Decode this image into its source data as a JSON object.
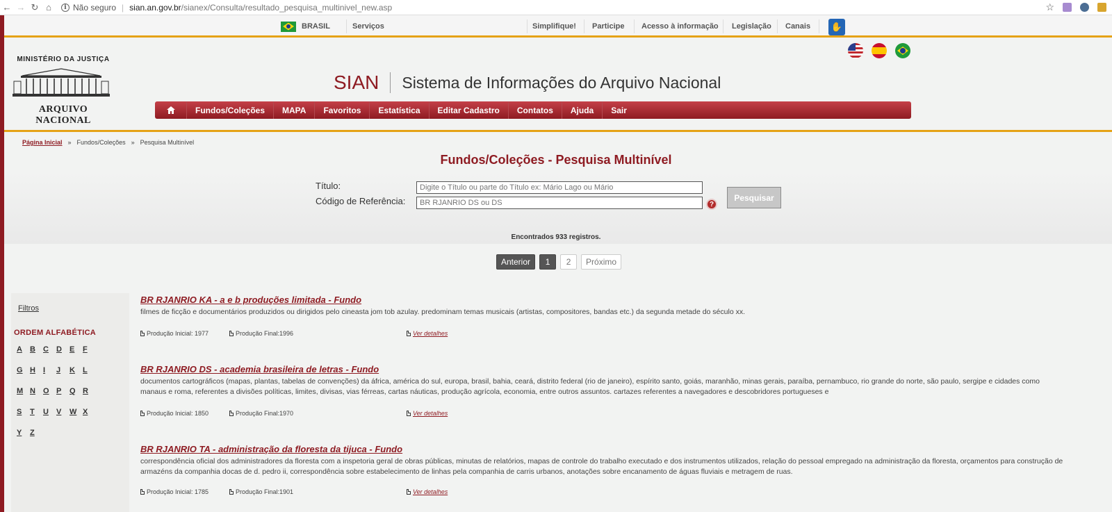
{
  "browser": {
    "security": "Não seguro",
    "url_host": "sian.an.gov.br",
    "url_path": "/sianex/Consulta/resultado_pesquisa_multinivel_new.asp"
  },
  "gov_bar": {
    "country": "BRASIL",
    "services": "Serviços",
    "links": [
      "Simplifique!",
      "Participe",
      "Acesso à informação",
      "Legislação",
      "Canais"
    ]
  },
  "header": {
    "ministry": "MINISTÉRIO DA JUSTIÇA",
    "org": "ARQUIVO NACIONAL",
    "abbr": "SIAN",
    "system_name": "Sistema de Informações do Arquivo Nacional"
  },
  "nav": {
    "home_icon": "home-icon",
    "items": [
      "Fundos/Coleções",
      "MAPA",
      "Favoritos",
      "Estatística",
      "Editar Cadastro",
      "Contatos",
      "Ajuda",
      "Sair"
    ]
  },
  "breadcrumb": {
    "home": "Página Inicial",
    "sep": "»",
    "level1": "Fundos/Coleções",
    "current": "Pesquisa Multinível"
  },
  "page_title": "Fundos/Coleções - Pesquisa Multinível",
  "search": {
    "title_label": "Título:",
    "title_placeholder": "Digite o Título ou parte do Título ex: Mário Lago ou Mário",
    "code_label": "Código de Referência:",
    "code_placeholder": "BR RJANRIO DS ou DS",
    "button": "Pesquisar"
  },
  "results_count": "Encontrados 933 registros.",
  "pagination": {
    "prev": "Anterior",
    "pages": [
      "1",
      "2"
    ],
    "current": "1",
    "next": "Próximo"
  },
  "sidebar": {
    "filters": "Filtros",
    "alpha_title": "ORDEM ALFABÉTICA",
    "rows": [
      [
        "A",
        "B",
        "C",
        "D",
        "E",
        "F"
      ],
      [
        "G",
        "H",
        "I",
        "J",
        "K",
        "L"
      ],
      [
        "M",
        "N",
        "O",
        "P",
        "Q",
        "R"
      ],
      [
        "S",
        "T",
        "U",
        "V",
        "W",
        "X"
      ],
      [
        "Y",
        "Z"
      ]
    ]
  },
  "results": [
    {
      "title": "BR RJANRIO KA - a e b produções limitada - Fundo",
      "desc": [
        "filmes de ficção e documentários produzidos ou dirigidos pelo cineasta jom tob azulay. predominam temas musicais (artistas, compositores, bandas etc.) da segunda metade do século xx."
      ],
      "start": "Produção Inicial: 1977",
      "end": "Produção Final:1996",
      "link": "Ver detalhes"
    },
    {
      "title": "BR RJANRIO DS - academia brasileira de letras - Fundo",
      "desc": [
        "documentos cartográficos (mapas, plantas, tabelas de convenções) da áfrica, américa do sul, europa, brasil, bahia, ceará, distrito federal (rio de janeiro), espírito santo, goiás, maranhão, minas gerais, paraíba, pernambuco, rio grande do norte, são paulo, sergipe e cidades como",
        "manaus e roma, referentes a divisões políticas, limites, divisas, vias férreas, cartas náuticas, produção agrícola, economia, entre outros assuntos. cartazes referentes a navegadores e descobridores portugueses e"
      ],
      "start": "Produção Inicial: 1850",
      "end": "Produção Final:1970",
      "link": "Ver detalhes"
    },
    {
      "title": "BR RJANRIO TA - administração da floresta da tijuca - Fundo",
      "desc": [
        "correspondência oficial dos administradores da floresta com a inspetoria geral de obras públicas, minutas de relatórios, mapas de controle do trabalho executado e dos instrumentos utilizados, relação do pessoal empregado na administração da floresta, orçamentos para construção de",
        "armazéns da companhia docas de d. pedro ii, correspondência sobre estabelecimento de linhas pela companhia de carris urbanos, anotações sobre encanamento de águas fluviais e metragem de ruas."
      ],
      "start": "Produção Inicial: 1785",
      "end": "Produção Final:1901",
      "link": "Ver detalhes"
    }
  ]
}
